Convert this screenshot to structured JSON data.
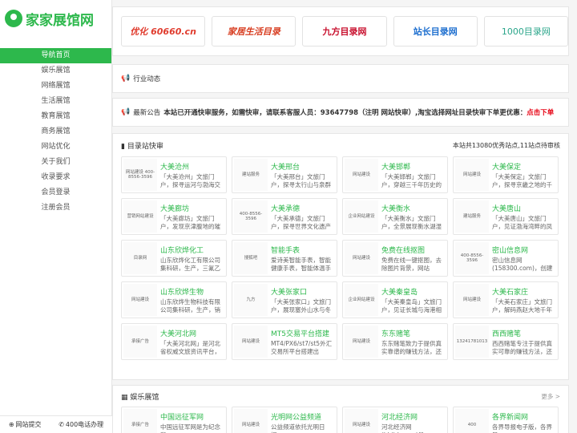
{
  "logo": {
    "text": "家家展馆网"
  },
  "nav": [
    {
      "label": "导航首页",
      "active": true
    },
    {
      "label": "娱乐展馆"
    },
    {
      "label": "网络展馆"
    },
    {
      "label": "生活展馆"
    },
    {
      "label": "教育展馆"
    },
    {
      "label": "商务展馆"
    },
    {
      "label": "网站优化"
    },
    {
      "label": "关于我们"
    },
    {
      "label": "收录要求"
    },
    {
      "label": "会员登录"
    },
    {
      "label": "注册会员"
    }
  ],
  "footer": {
    "submit": "网站提交",
    "phone": "400电话办理"
  },
  "sponsors": [
    {
      "label": "优化 60660.cn"
    },
    {
      "label": "家居生活目录"
    },
    {
      "label": "九方目录网"
    },
    {
      "label": "站长目录网"
    },
    {
      "label": "1000目录网"
    }
  ],
  "industry": {
    "title": "行业动态"
  },
  "notice": {
    "label": "最新公告",
    "text": "本站已开通快审服务，如需快审，请联系客服人员：93647798（注明 网站快审）,淘宝选择网址目录快审下单更优惠：",
    "link": "点击下单"
  },
  "directory": {
    "title": "目录站快审",
    "stats": "本站共13080优秀站点,11站点待审核",
    "items": [
      {
        "thumb": "网站建设 400-8556-3596",
        "title": "大美沧州",
        "desc": "「大美沧州」文旅门户，探寻运河与渤海交汇的文"
      },
      {
        "thumb": "建站服务",
        "title": "大美邢台",
        "desc": "「大美邢台」文旅门户，探寻太行山与泉群共舞的"
      },
      {
        "thumb": "网站建设",
        "title": "大美邯郸",
        "desc": "「大美邯郸」文旅门户，穿越三千年历史的成语之"
      },
      {
        "thumb": "网站建设",
        "title": "大美保定",
        "desc": "「大美保定」文旅门户，探寻京畿之地的千年风华"
      },
      {
        "thumb": "营销网站建设",
        "title": "大美廊坊",
        "desc": "「大美廊坊」文旅门户，发现京津腹地的璀璨明珠"
      },
      {
        "thumb": "400-8556-3596",
        "title": "大美承德",
        "desc": "「大美承德」文旅门户，探寻世界文化遗产的山水"
      },
      {
        "thumb": "企业网站建设",
        "title": "大美衡水",
        "desc": "「大美衡水」文旅门户，全景展现衡水湖湿地魅力"
      },
      {
        "thumb": "建站服务",
        "title": "大美唐山",
        "desc": "「大美唐山」文旅门户，见证渤海湾畔的凤凰涅槃"
      },
      {
        "thumb": "目录网",
        "title": "山东欣烨化工",
        "desc": "山东欣烨化工有限公司集科研，生产，三氟乙酸"
      },
      {
        "thumb": "搜狐吧",
        "title": "智能手表",
        "desc": "爱诗美智能手表，智能健康手表，智能体温手表，智能"
      },
      {
        "thumb": "网站建设",
        "title": "免费在线抠图",
        "desc": "免费在线一键抠图，去除图片背景，网站"
      },
      {
        "thumb": "400-8556-3596",
        "title": "密山信息网",
        "desc": "密山信息网(158300.com)，创建于2010年1月1日，"
      },
      {
        "thumb": "网站建设",
        "title": "山东欣烨生物",
        "desc": "山东欣烨生物科技有限公司集科研，生产，销售对"
      },
      {
        "thumb": "九方",
        "title": "大美张家口",
        "desc": "「大美张家口」文旅门户，展现塞外山水与冬奥风"
      },
      {
        "thumb": "企业网站建设",
        "title": "大美秦皇岛",
        "desc": "「大美秦皇岛」文旅门户，见证长城与海港相拥的"
      },
      {
        "thumb": "网站建设",
        "title": "大美石家庄",
        "desc": "「大美石家庄」文旅门户，解码燕赵大地千年文化"
      },
      {
        "thumb": "承接广告",
        "title": "大美河北网",
        "desc": "「大美河北网」是河北省权威文旅资讯平台，以'这"
      },
      {
        "thumb": "网站建设",
        "title": "MT5交易平台搭建",
        "desc": "MT4/PX6/st7/st5外汇交易所平台搭建出租,MT4系"
      },
      {
        "thumb": "网站建设",
        "title": "东东赌笔",
        "desc": "东东赌笔致力于提供真实靠谱的赚钱方法，还有创业"
      },
      {
        "thumb": "13241781013",
        "title": "西西赌笔",
        "desc": "西西赌笔专注于提供真实可靠的赚钱方法，还有创业"
      }
    ]
  },
  "entertainment": {
    "title": "娱乐展馆",
    "more": "更多 >",
    "items": [
      {
        "thumb": "承接广告",
        "title": "中国远征军网",
        "desc": "中国远征军网是为纪念和"
      },
      {
        "thumb": "网站建设",
        "title": "光明网公益频道",
        "desc": "公益频道依托光明日报，"
      },
      {
        "thumb": "网站建设",
        "title": "河北经济网",
        "desc": "河北经济网(hbjjrb.com)是"
      },
      {
        "thumb": "400",
        "title": "各界新闻网",
        "desc": "各界导报电子版，各界导"
      }
    ]
  }
}
